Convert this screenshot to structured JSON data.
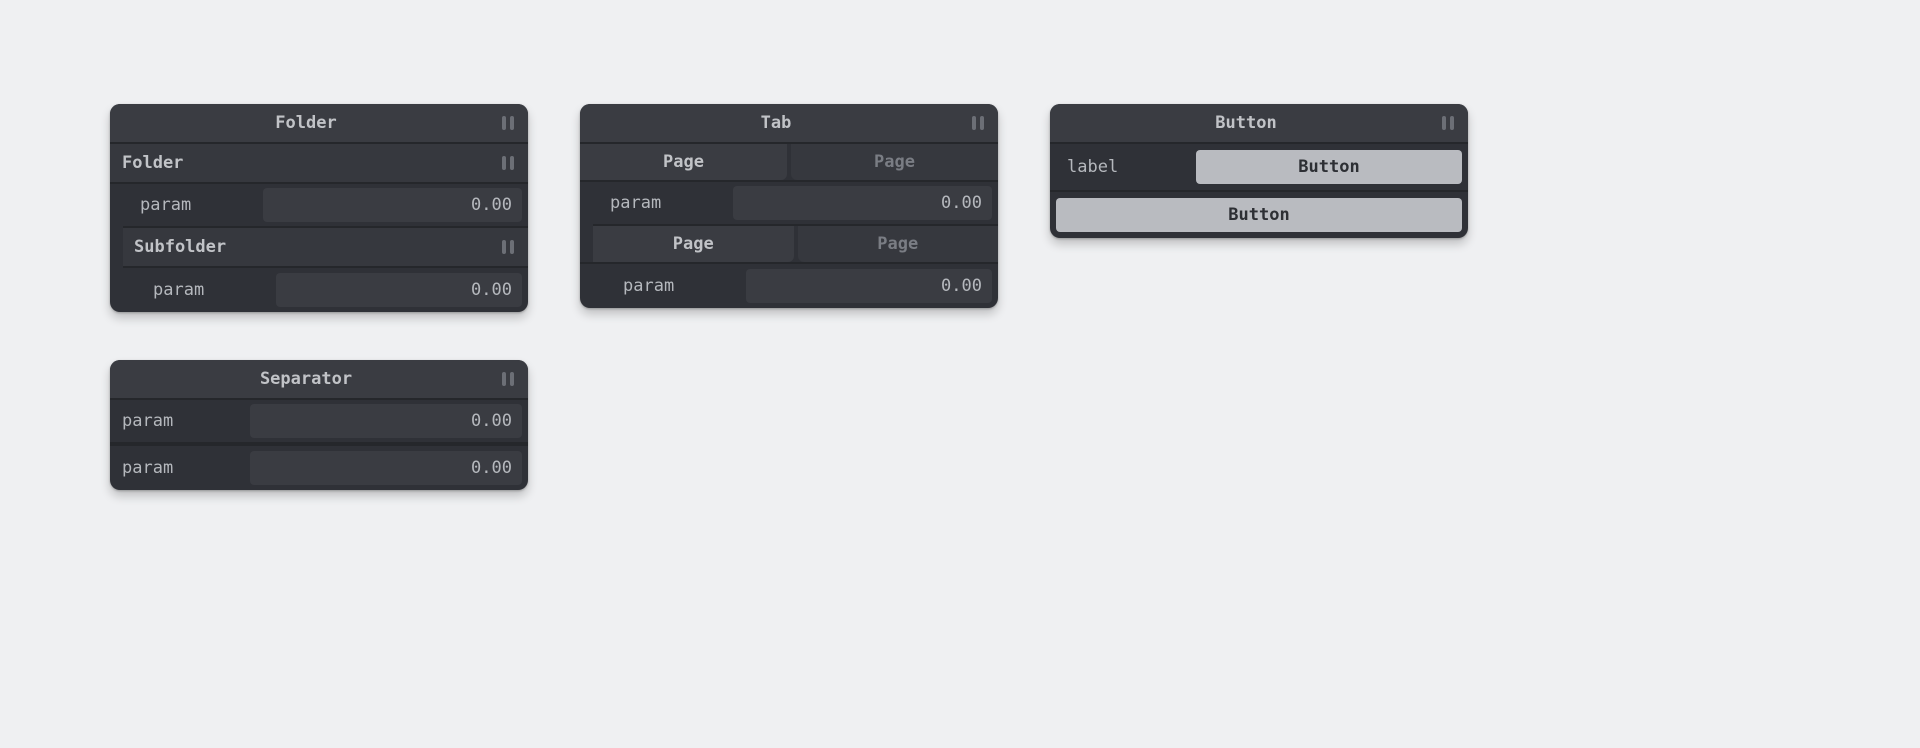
{
  "panes": {
    "folder": {
      "title": "Folder",
      "sub1": {
        "title": "Folder",
        "param": {
          "label": "param",
          "value": "0.00"
        }
      },
      "sub2": {
        "title": "Subfolder",
        "param": {
          "label": "param",
          "value": "0.00"
        }
      }
    },
    "tab": {
      "title": "Tab",
      "group1": {
        "tabs": [
          "Page",
          "Page"
        ],
        "param": {
          "label": "param",
          "value": "0.00"
        }
      },
      "group2": {
        "tabs": [
          "Page",
          "Page"
        ],
        "param": {
          "label": "param",
          "value": "0.00"
        }
      }
    },
    "button": {
      "title": "Button",
      "row1": {
        "label": "label",
        "button": "Button"
      },
      "row2": {
        "button": "Button"
      }
    },
    "separator": {
      "title": "Separator",
      "param1": {
        "label": "param",
        "value": "0.00"
      },
      "param2": {
        "label": "param",
        "value": "0.00"
      }
    }
  }
}
